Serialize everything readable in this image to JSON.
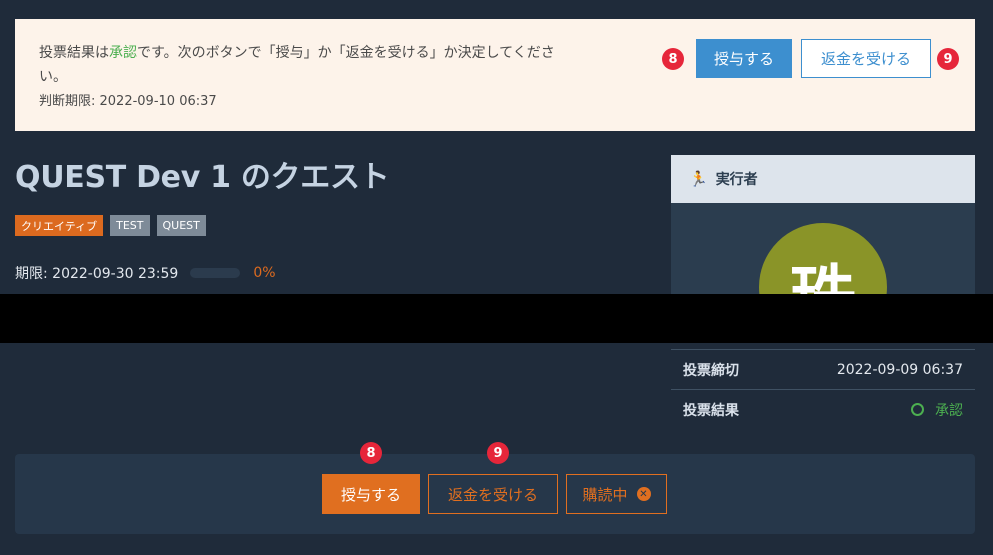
{
  "notice": {
    "text_prefix": "投票結果は",
    "result": "承認",
    "text_suffix": "です。次のボタンで「授与」か「返金を受ける」か決定してください。",
    "deadline_label": "判断期限: 2022-09-10 06:37",
    "grant_label": "授与する",
    "refund_label": "返金を受ける",
    "marker_grant": "8",
    "marker_refund": "9"
  },
  "quest": {
    "title": "QUEST Dev 1 のクエスト",
    "tags": [
      "クリエイティブ",
      "TEST",
      "QUEST"
    ],
    "deadline": "期限: 2022-09-30 23:59",
    "progress_percent": 0,
    "progress_label": "0%"
  },
  "panel": {
    "header": "実行者",
    "avatar_glyph": "珠"
  },
  "vote": {
    "deadline_key": "投票締切",
    "deadline_value": "2022-09-09 06:37",
    "result_key": "投票結果",
    "result_value": "承認"
  },
  "actions": {
    "grant_label": "授与する",
    "refund_label": "返金を受ける",
    "subscribe_label": "購読中",
    "marker_grant": "8",
    "marker_refund": "9"
  },
  "colors": {
    "accent_orange": "#e06f20",
    "accent_blue": "#3d8fcf",
    "approve_green": "#4caf50",
    "marker_red": "#e6263a"
  }
}
